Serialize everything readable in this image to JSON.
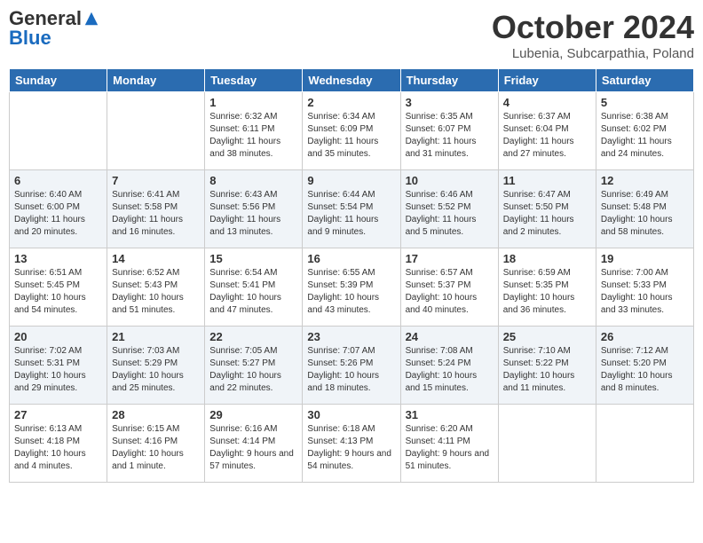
{
  "header": {
    "logo_general": "General",
    "logo_blue": "Blue",
    "month": "October 2024",
    "location": "Lubenia, Subcarpathia, Poland"
  },
  "days_of_week": [
    "Sunday",
    "Monday",
    "Tuesday",
    "Wednesday",
    "Thursday",
    "Friday",
    "Saturday"
  ],
  "weeks": [
    [
      {
        "day": "",
        "info": ""
      },
      {
        "day": "",
        "info": ""
      },
      {
        "day": "1",
        "sunrise": "6:32 AM",
        "sunset": "6:11 PM",
        "daylight": "11 hours and 38 minutes."
      },
      {
        "day": "2",
        "sunrise": "6:34 AM",
        "sunset": "6:09 PM",
        "daylight": "11 hours and 35 minutes."
      },
      {
        "day": "3",
        "sunrise": "6:35 AM",
        "sunset": "6:07 PM",
        "daylight": "11 hours and 31 minutes."
      },
      {
        "day": "4",
        "sunrise": "6:37 AM",
        "sunset": "6:04 PM",
        "daylight": "11 hours and 27 minutes."
      },
      {
        "day": "5",
        "sunrise": "6:38 AM",
        "sunset": "6:02 PM",
        "daylight": "11 hours and 24 minutes."
      }
    ],
    [
      {
        "day": "6",
        "sunrise": "6:40 AM",
        "sunset": "6:00 PM",
        "daylight": "11 hours and 20 minutes."
      },
      {
        "day": "7",
        "sunrise": "6:41 AM",
        "sunset": "5:58 PM",
        "daylight": "11 hours and 16 minutes."
      },
      {
        "day": "8",
        "sunrise": "6:43 AM",
        "sunset": "5:56 PM",
        "daylight": "11 hours and 13 minutes."
      },
      {
        "day": "9",
        "sunrise": "6:44 AM",
        "sunset": "5:54 PM",
        "daylight": "11 hours and 9 minutes."
      },
      {
        "day": "10",
        "sunrise": "6:46 AM",
        "sunset": "5:52 PM",
        "daylight": "11 hours and 5 minutes."
      },
      {
        "day": "11",
        "sunrise": "6:47 AM",
        "sunset": "5:50 PM",
        "daylight": "11 hours and 2 minutes."
      },
      {
        "day": "12",
        "sunrise": "6:49 AM",
        "sunset": "5:48 PM",
        "daylight": "10 hours and 58 minutes."
      }
    ],
    [
      {
        "day": "13",
        "sunrise": "6:51 AM",
        "sunset": "5:45 PM",
        "daylight": "10 hours and 54 minutes."
      },
      {
        "day": "14",
        "sunrise": "6:52 AM",
        "sunset": "5:43 PM",
        "daylight": "10 hours and 51 minutes."
      },
      {
        "day": "15",
        "sunrise": "6:54 AM",
        "sunset": "5:41 PM",
        "daylight": "10 hours and 47 minutes."
      },
      {
        "day": "16",
        "sunrise": "6:55 AM",
        "sunset": "5:39 PM",
        "daylight": "10 hours and 43 minutes."
      },
      {
        "day": "17",
        "sunrise": "6:57 AM",
        "sunset": "5:37 PM",
        "daylight": "10 hours and 40 minutes."
      },
      {
        "day": "18",
        "sunrise": "6:59 AM",
        "sunset": "5:35 PM",
        "daylight": "10 hours and 36 minutes."
      },
      {
        "day": "19",
        "sunrise": "7:00 AM",
        "sunset": "5:33 PM",
        "daylight": "10 hours and 33 minutes."
      }
    ],
    [
      {
        "day": "20",
        "sunrise": "7:02 AM",
        "sunset": "5:31 PM",
        "daylight": "10 hours and 29 minutes."
      },
      {
        "day": "21",
        "sunrise": "7:03 AM",
        "sunset": "5:29 PM",
        "daylight": "10 hours and 25 minutes."
      },
      {
        "day": "22",
        "sunrise": "7:05 AM",
        "sunset": "5:27 PM",
        "daylight": "10 hours and 22 minutes."
      },
      {
        "day": "23",
        "sunrise": "7:07 AM",
        "sunset": "5:26 PM",
        "daylight": "10 hours and 18 minutes."
      },
      {
        "day": "24",
        "sunrise": "7:08 AM",
        "sunset": "5:24 PM",
        "daylight": "10 hours and 15 minutes."
      },
      {
        "day": "25",
        "sunrise": "7:10 AM",
        "sunset": "5:22 PM",
        "daylight": "10 hours and 11 minutes."
      },
      {
        "day": "26",
        "sunrise": "7:12 AM",
        "sunset": "5:20 PM",
        "daylight": "10 hours and 8 minutes."
      }
    ],
    [
      {
        "day": "27",
        "sunrise": "6:13 AM",
        "sunset": "4:18 PM",
        "daylight": "10 hours and 4 minutes."
      },
      {
        "day": "28",
        "sunrise": "6:15 AM",
        "sunset": "4:16 PM",
        "daylight": "10 hours and 1 minute."
      },
      {
        "day": "29",
        "sunrise": "6:16 AM",
        "sunset": "4:14 PM",
        "daylight": "9 hours and 57 minutes."
      },
      {
        "day": "30",
        "sunrise": "6:18 AM",
        "sunset": "4:13 PM",
        "daylight": "9 hours and 54 minutes."
      },
      {
        "day": "31",
        "sunrise": "6:20 AM",
        "sunset": "4:11 PM",
        "daylight": "9 hours and 51 minutes."
      },
      {
        "day": "",
        "info": ""
      },
      {
        "day": "",
        "info": ""
      }
    ]
  ]
}
